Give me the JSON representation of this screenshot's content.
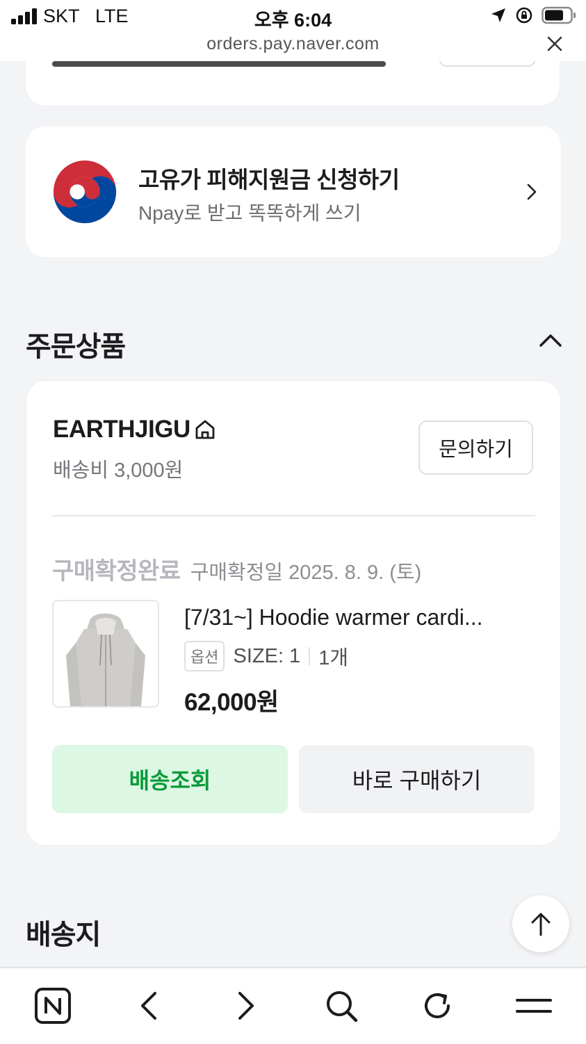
{
  "status_bar": {
    "carrier": "SKT",
    "network": "LTE",
    "time": "오후 6:04"
  },
  "browser": {
    "url": "orders.pay.naver.com"
  },
  "support_banner": {
    "title": "고유가 피해지원금 신청하기",
    "subtitle": "Npay로 받고 똑똑하게 쓰기"
  },
  "orders_section": {
    "title": "주문상품"
  },
  "order": {
    "store_name": "EARTHJIGU",
    "shipping_fee": "배송비 3,000원",
    "inquiry_button": "문의하기",
    "status": "구매확정완료",
    "status_date": "구매확정일 2025. 8. 9. (토)",
    "product_name": "[7/31~] Hoodie warmer cardi...",
    "option_badge": "옵션",
    "option_value": "SIZE: 1",
    "quantity": "1개",
    "price": "62,000원",
    "track_button": "배송조회",
    "buy_again_button": "바로 구매하기"
  },
  "address_section": {
    "title": "배송지"
  },
  "colors": {
    "accent_green": "#0a9a3a",
    "accent_green_bg": "#dcf7e3",
    "gov_red": "#cd2e3a",
    "gov_blue": "#0047a0"
  },
  "toolbar": {
    "icons": [
      "naver-n-icon",
      "back-icon",
      "forward-icon",
      "search-icon",
      "reload-icon",
      "menu-icon"
    ]
  }
}
